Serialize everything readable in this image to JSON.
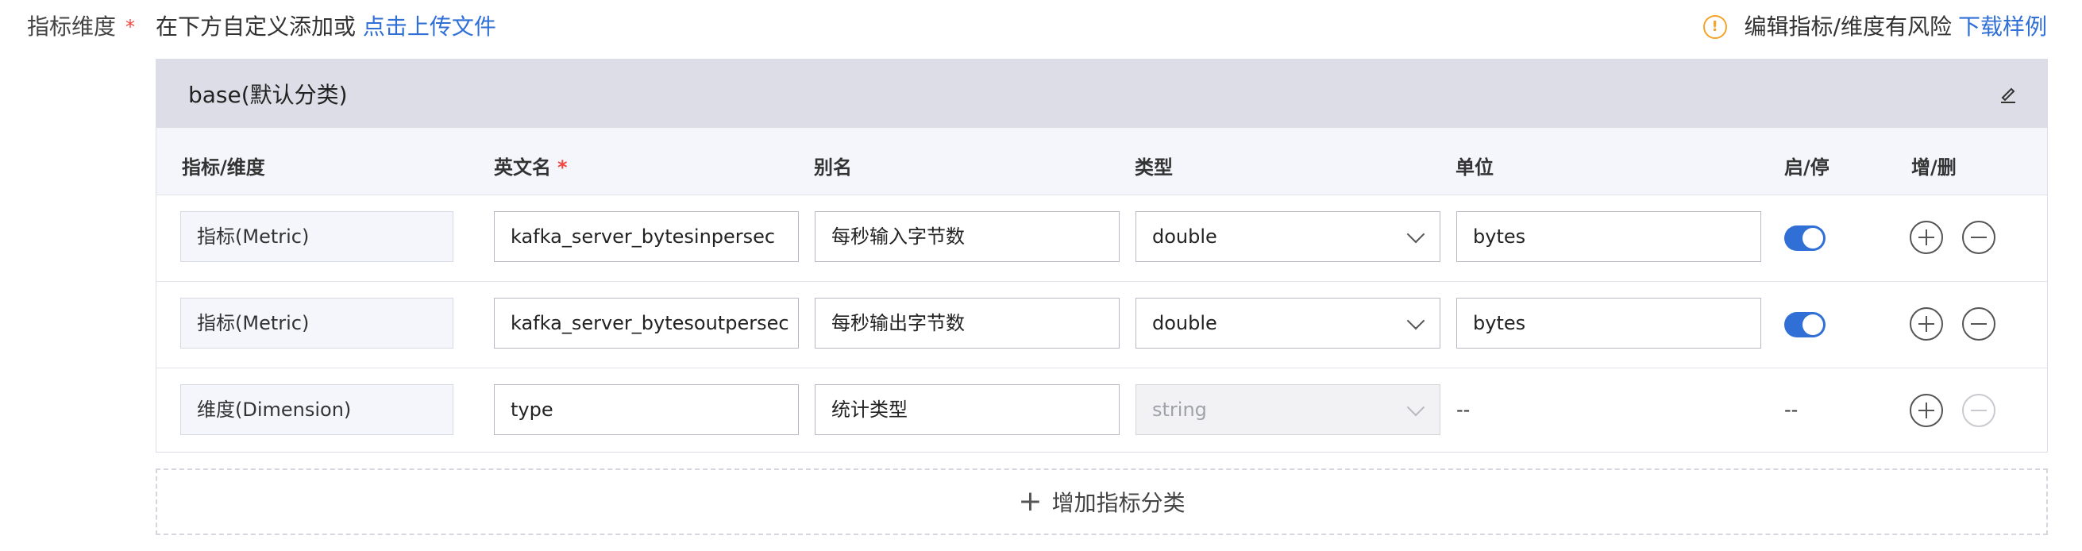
{
  "field": {
    "label": "指标维度",
    "required_mark": "*",
    "help_text": "在下方自定义添加或",
    "upload_link": "点击上传文件"
  },
  "warning": {
    "icon": "exclamation-circle",
    "text": "编辑指标/维度有风险",
    "download_link": "下载样例"
  },
  "category": {
    "title": "base(默认分类)",
    "edit_icon": "pencil-edit"
  },
  "columns": {
    "type": "指标/维度",
    "name": "英文名",
    "name_required": "*",
    "alias": "别名",
    "data_type": "类型",
    "unit": "单位",
    "enabled": "启/停",
    "add_remove": "增/删"
  },
  "rows": [
    {
      "kind": "指标(Metric)",
      "name": "kafka_server_bytesinpersec",
      "alias": "每秒输入字节数",
      "data_type": "double",
      "unit": "bytes",
      "enabled": true
    },
    {
      "kind": "指标(Metric)",
      "name": "kafka_server_bytesoutpersec",
      "alias": "每秒输出字节数",
      "data_type": "double",
      "unit": "bytes",
      "enabled": true
    },
    {
      "kind": "维度(Dimension)",
      "name": "type",
      "alias": "统计类型",
      "data_type": "string",
      "unit": "--",
      "enabled_text": "--"
    }
  ],
  "add_category": {
    "label": "增加指标分类"
  },
  "colors": {
    "accent": "#2f6fd6",
    "warning": "#f5a32a",
    "required": "#f0463e",
    "header_bg": "#dcdde6"
  }
}
